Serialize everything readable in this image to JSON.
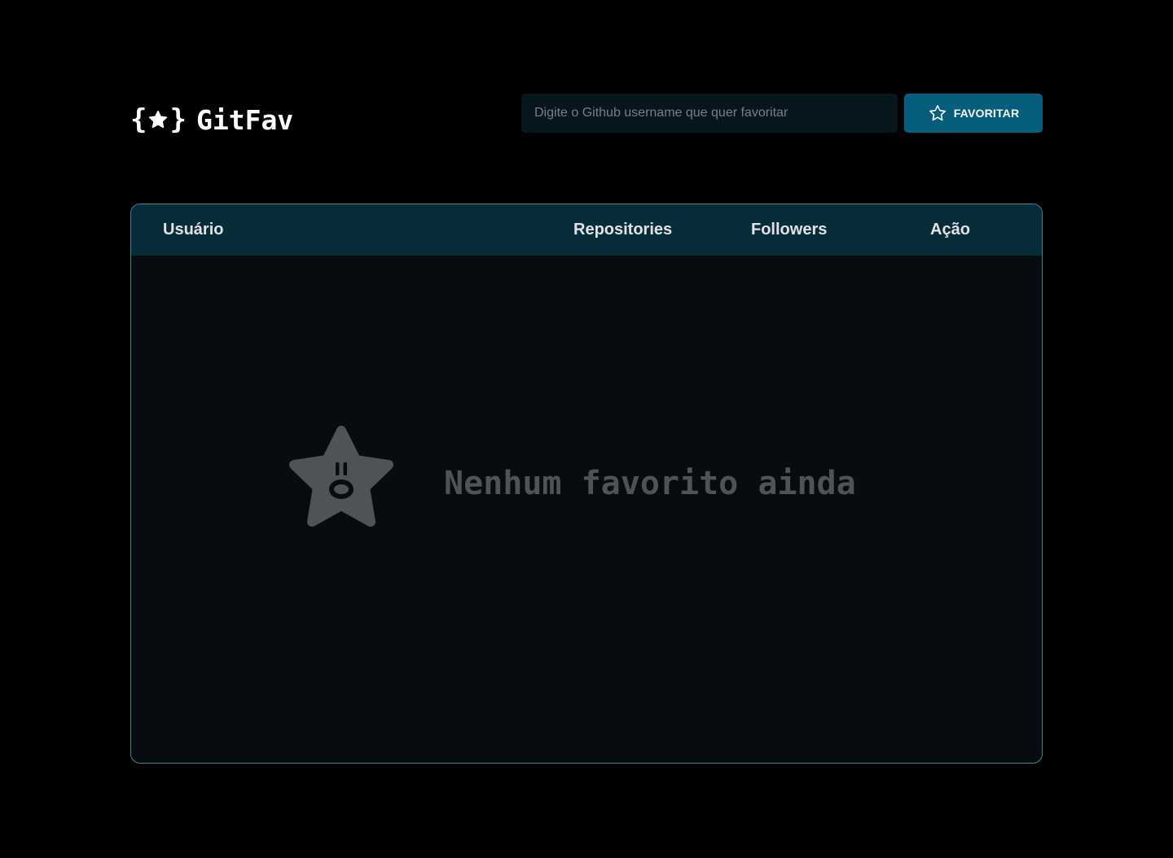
{
  "app": {
    "name": "GitFav"
  },
  "search": {
    "placeholder": "Digite o Github username que quer favoritar",
    "value": "",
    "button_label": "FAVORITAR"
  },
  "table": {
    "columns": [
      "Usuário",
      "Repositories",
      "Followers",
      "Ação"
    ],
    "rows": [],
    "empty_message": "Nenhum favorito ainda"
  },
  "colors": {
    "background": "#000000",
    "input_background": "#06161c",
    "button": "#065e7c",
    "table_header": "#092d38",
    "table_body": "#060c0f",
    "table_border": "#4a808c",
    "empty_text": "#4e5455"
  },
  "icons": {
    "logo": "braces-star-icon",
    "button": "star-outline-icon",
    "empty": "surprised-star-icon"
  }
}
